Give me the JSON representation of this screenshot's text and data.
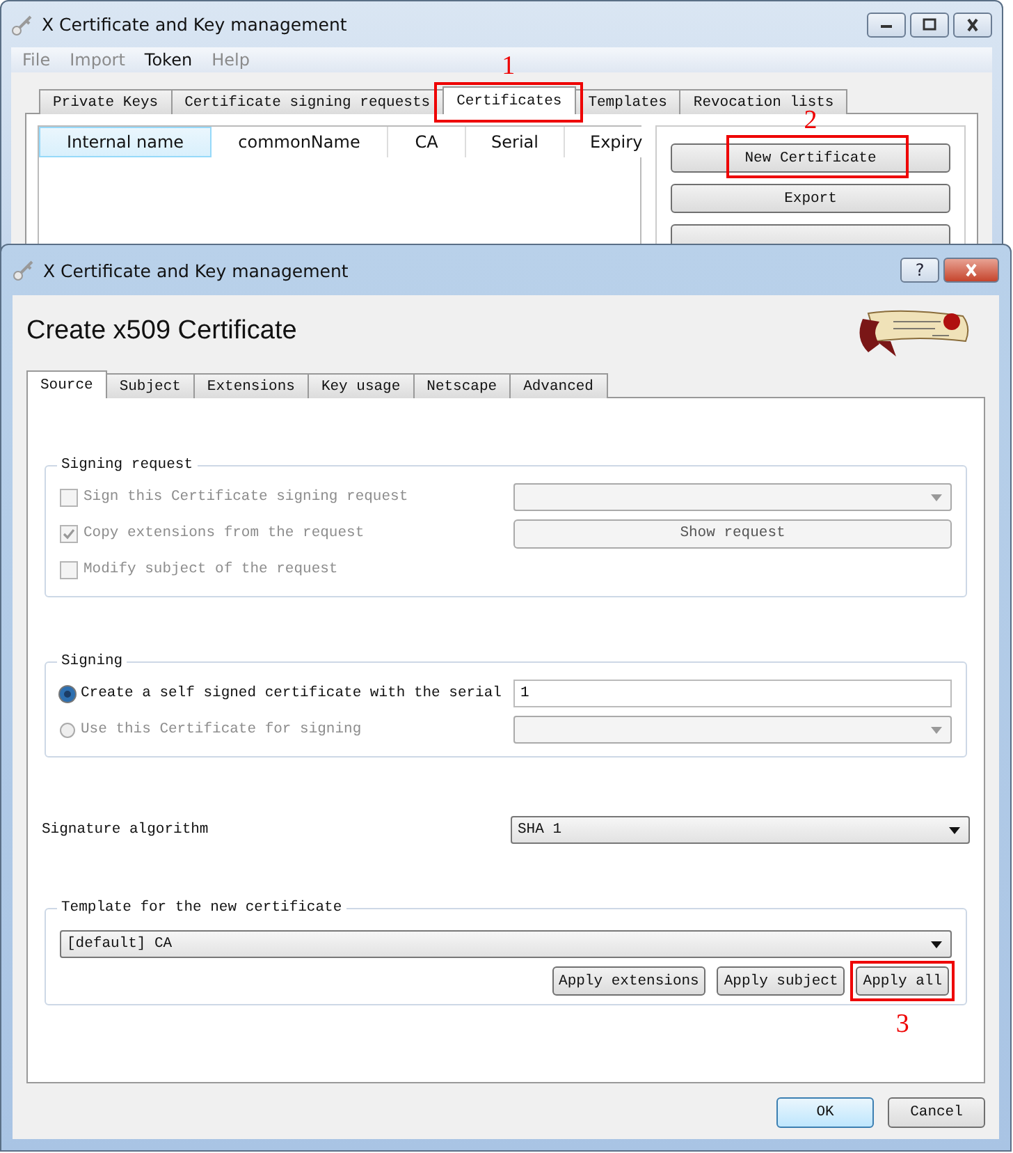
{
  "main_window": {
    "title": "X Certificate and Key management",
    "menu": [
      {
        "label": "File",
        "disabled": true
      },
      {
        "label": "Import",
        "disabled": true
      },
      {
        "label": "Token",
        "disabled": false
      },
      {
        "label": "Help",
        "disabled": true
      }
    ],
    "tabs": [
      {
        "label": "Private Keys",
        "selected": false
      },
      {
        "label": "Certificate signing requests",
        "selected": false
      },
      {
        "label": "Certificates",
        "selected": true,
        "annotation": {
          "label": "1",
          "below": false
        }
      },
      {
        "label": "Templates",
        "selected": false
      },
      {
        "label": "Revocation lists",
        "selected": false
      }
    ],
    "table": {
      "columns": [
        {
          "label": "Internal name",
          "sorted": true
        },
        {
          "label": "commonName",
          "sorted": false
        },
        {
          "label": "CA",
          "sorted": false
        },
        {
          "label": "Serial",
          "sorted": false
        },
        {
          "label": "Expiry",
          "sorted": false
        }
      ]
    },
    "buttons": [
      {
        "label": "New Certificate",
        "annotation": {
          "label": "2",
          "below": false
        }
      },
      {
        "label": "Export"
      }
    ]
  },
  "dialog": {
    "title": "X Certificate and Key management",
    "help_label": "?",
    "heading": "Create x509 Certificate",
    "tabs": [
      {
        "label": "Source",
        "selected": true
      },
      {
        "label": "Subject",
        "selected": false
      },
      {
        "label": "Extensions",
        "selected": false
      },
      {
        "label": "Key usage",
        "selected": false
      },
      {
        "label": "Netscape",
        "selected": false
      },
      {
        "label": "Advanced",
        "selected": false
      }
    ],
    "signing_request": {
      "title": "Signing request",
      "options": [
        {
          "label": "Sign this Certificate signing request",
          "checked": false,
          "disabled": true
        },
        {
          "label": "Copy extensions from the request",
          "checked": true,
          "disabled": true
        },
        {
          "label": "Modify subject of the request",
          "checked": false,
          "disabled": true
        }
      ],
      "show_request_button": "Show request"
    },
    "signing": {
      "title": "Signing",
      "options": [
        {
          "label": "Create a self signed certificate with the serial",
          "selected": true,
          "disabled": false
        },
        {
          "label": "Use this Certificate for signing",
          "selected": false,
          "disabled": true
        }
      ],
      "serial": "1"
    },
    "signature_algorithm": {
      "label": "Signature algorithm",
      "value": "SHA 1"
    },
    "template": {
      "title": "Template for the new certificate",
      "value": "[default] CA",
      "buttons": [
        {
          "label": "Apply extensions"
        },
        {
          "label": "Apply subject"
        },
        {
          "label": "Apply all",
          "annotation": {
            "label": "3",
            "below": true
          }
        }
      ]
    },
    "footer_buttons": [
      {
        "label": "OK",
        "default": true
      },
      {
        "label": "Cancel",
        "default": false
      }
    ]
  }
}
